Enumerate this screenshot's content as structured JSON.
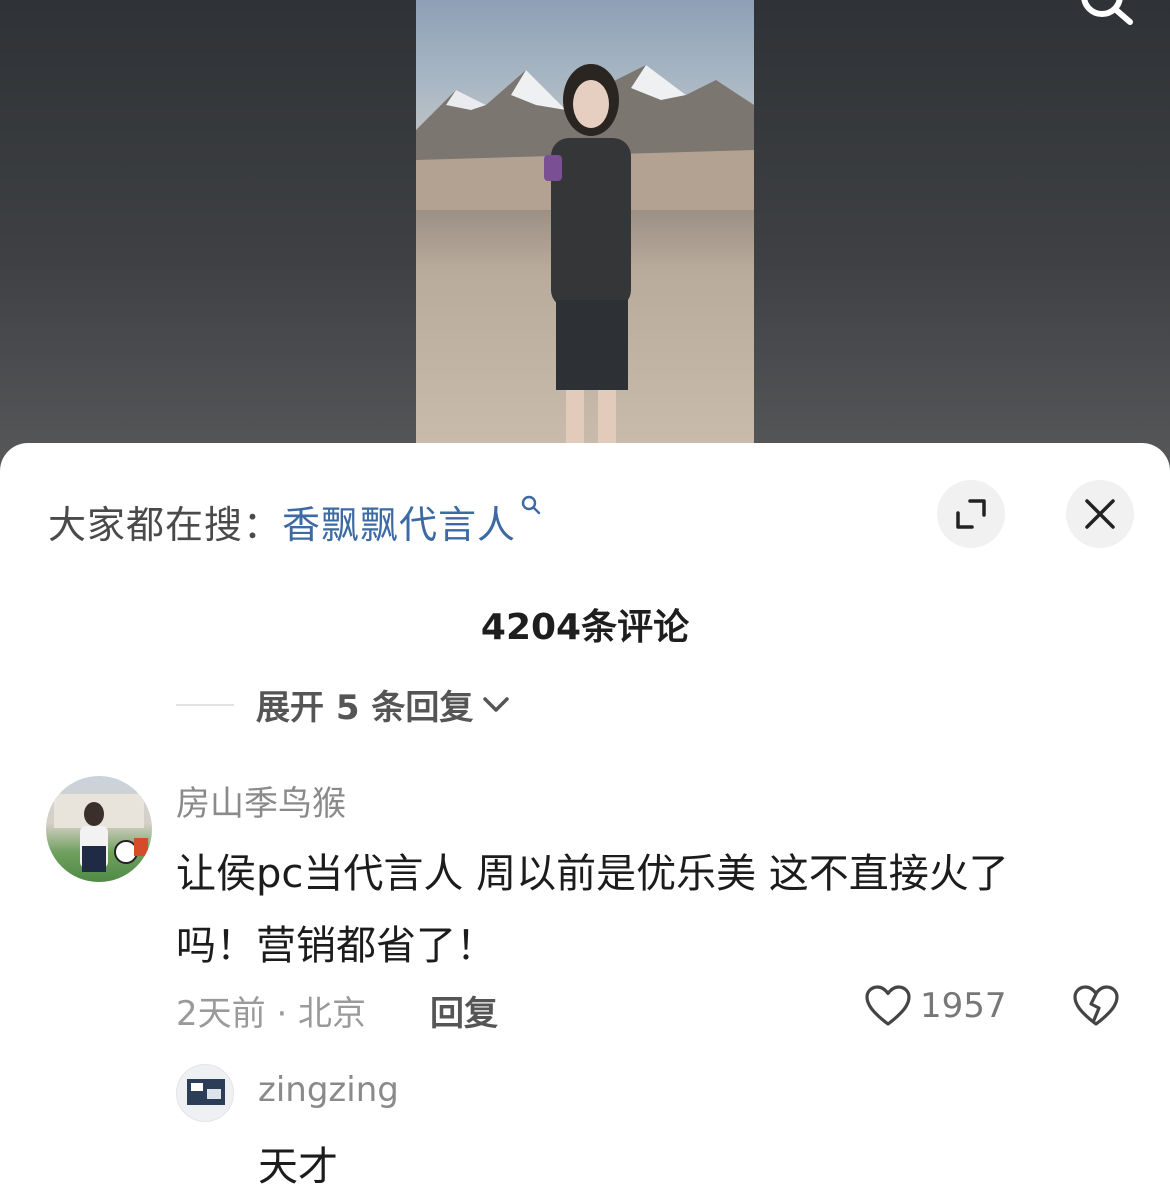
{
  "search_bar": {
    "prefix": "大家都在搜：",
    "term": "香飘飘代言人"
  },
  "comments_header": {
    "title": "4204条评论"
  },
  "expand": {
    "label": "展开 5 条回复"
  },
  "comments": [
    {
      "username": "房山季鸟猴",
      "text": "让侯pc当代言人 周以前是优乐美 这不直接火了吗！营销都省了！",
      "time_location": "2天前 · 北京",
      "reply_label": "回复",
      "likes": "1957"
    }
  ],
  "replies": [
    {
      "username": "zingzing",
      "text": "天才"
    }
  ],
  "icons": {
    "search": "search-icon",
    "expand": "expand-icon",
    "close": "close-icon",
    "chevron": "chevron-down-icon",
    "like": "heart-icon",
    "dislike": "broken-heart-icon"
  },
  "colors": {
    "search_term": "#3d6aa3",
    "sheet": "#ffffff"
  }
}
